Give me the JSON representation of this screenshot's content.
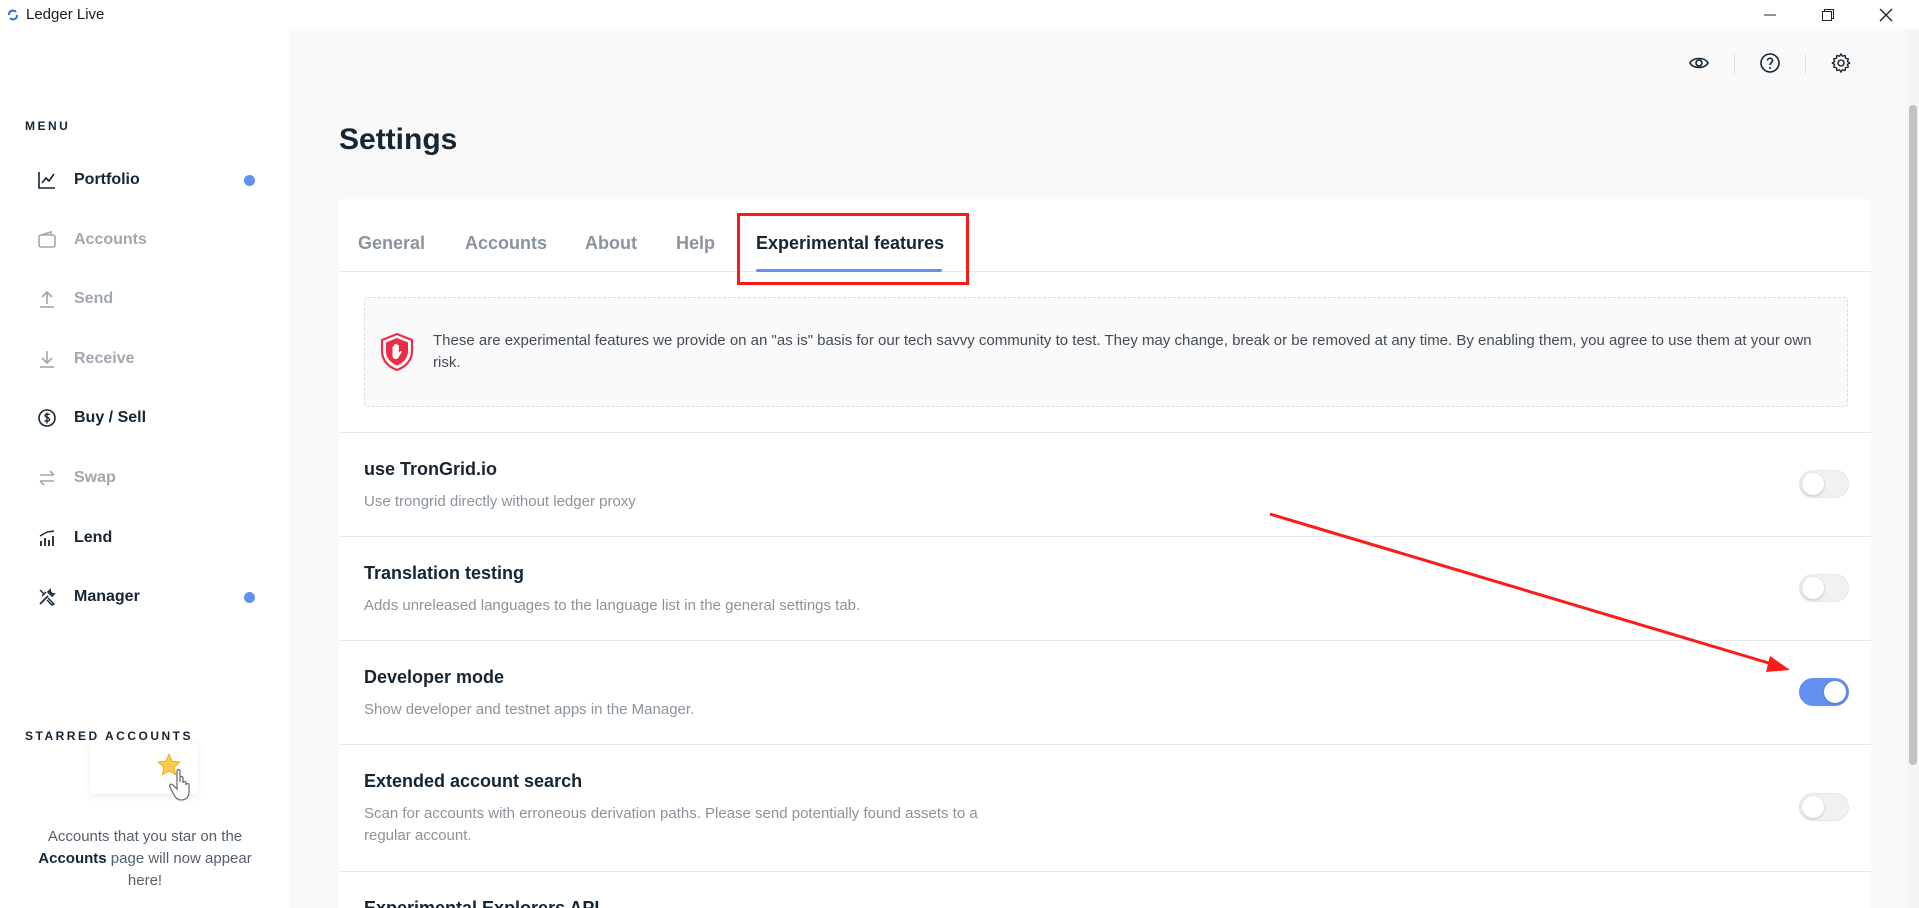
{
  "window": {
    "title": "Ledger Live"
  },
  "sidebar": {
    "menu_title": "MENU",
    "items": [
      {
        "label": "Portfolio",
        "icon": "chart-line-icon",
        "state": "active",
        "dot": true
      },
      {
        "label": "Accounts",
        "icon": "wallet-icon",
        "state": "dim",
        "dot": false
      },
      {
        "label": "Send",
        "icon": "arrow-up-icon",
        "state": "dim",
        "dot": false
      },
      {
        "label": "Receive",
        "icon": "arrow-down-icon",
        "state": "dim",
        "dot": false
      },
      {
        "label": "Buy / Sell",
        "icon": "dollar-circle-icon",
        "state": "active",
        "dot": false
      },
      {
        "label": "Swap",
        "icon": "swap-icon",
        "state": "dim",
        "dot": false
      },
      {
        "label": "Lend",
        "icon": "lend-chart-icon",
        "state": "active",
        "dot": false
      },
      {
        "label": "Manager",
        "icon": "tools-icon",
        "state": "active",
        "dot": true
      }
    ],
    "starred_title": "STARRED ACCOUNTS",
    "starred_text_before": "Accounts that you star on the ",
    "starred_text_bold": "Accounts",
    "starred_text_after": " page will now appear here!"
  },
  "header": {
    "icons": [
      "eye-icon",
      "help-circle-icon",
      "gear-icon"
    ]
  },
  "main": {
    "page_title": "Settings",
    "tabs": [
      {
        "label": "General",
        "active": false
      },
      {
        "label": "Accounts",
        "active": false
      },
      {
        "label": "About",
        "active": false
      },
      {
        "label": "Help",
        "active": false
      },
      {
        "label": "Experimental features",
        "active": true
      }
    ],
    "notice_text": "These are experimental features we provide on an \"as is\" basis for our tech savvy community to test. They may change, break or be removed at any time. By enabling them, you agree to use them at your own risk.",
    "rows": [
      {
        "title": "use TronGrid.io",
        "desc": "Use trongrid directly without ledger proxy",
        "enabled": false
      },
      {
        "title": "Translation testing",
        "desc": "Adds unreleased languages to the language list in the general settings tab.",
        "enabled": false
      },
      {
        "title": "Developer mode",
        "desc": "Show developer and testnet apps in the Manager.",
        "enabled": true
      },
      {
        "title": "Extended account search",
        "desc": "Scan for accounts with erroneous derivation paths. Please send potentially found assets to a regular account.",
        "enabled": false
      },
      {
        "title": "Experimental Explorers API",
        "desc": "",
        "enabled": false
      }
    ]
  },
  "colors": {
    "accent": "#6490f1",
    "annotation": "#ff1a1a",
    "text_primary": "#142533",
    "text_muted": "#8a939c"
  }
}
